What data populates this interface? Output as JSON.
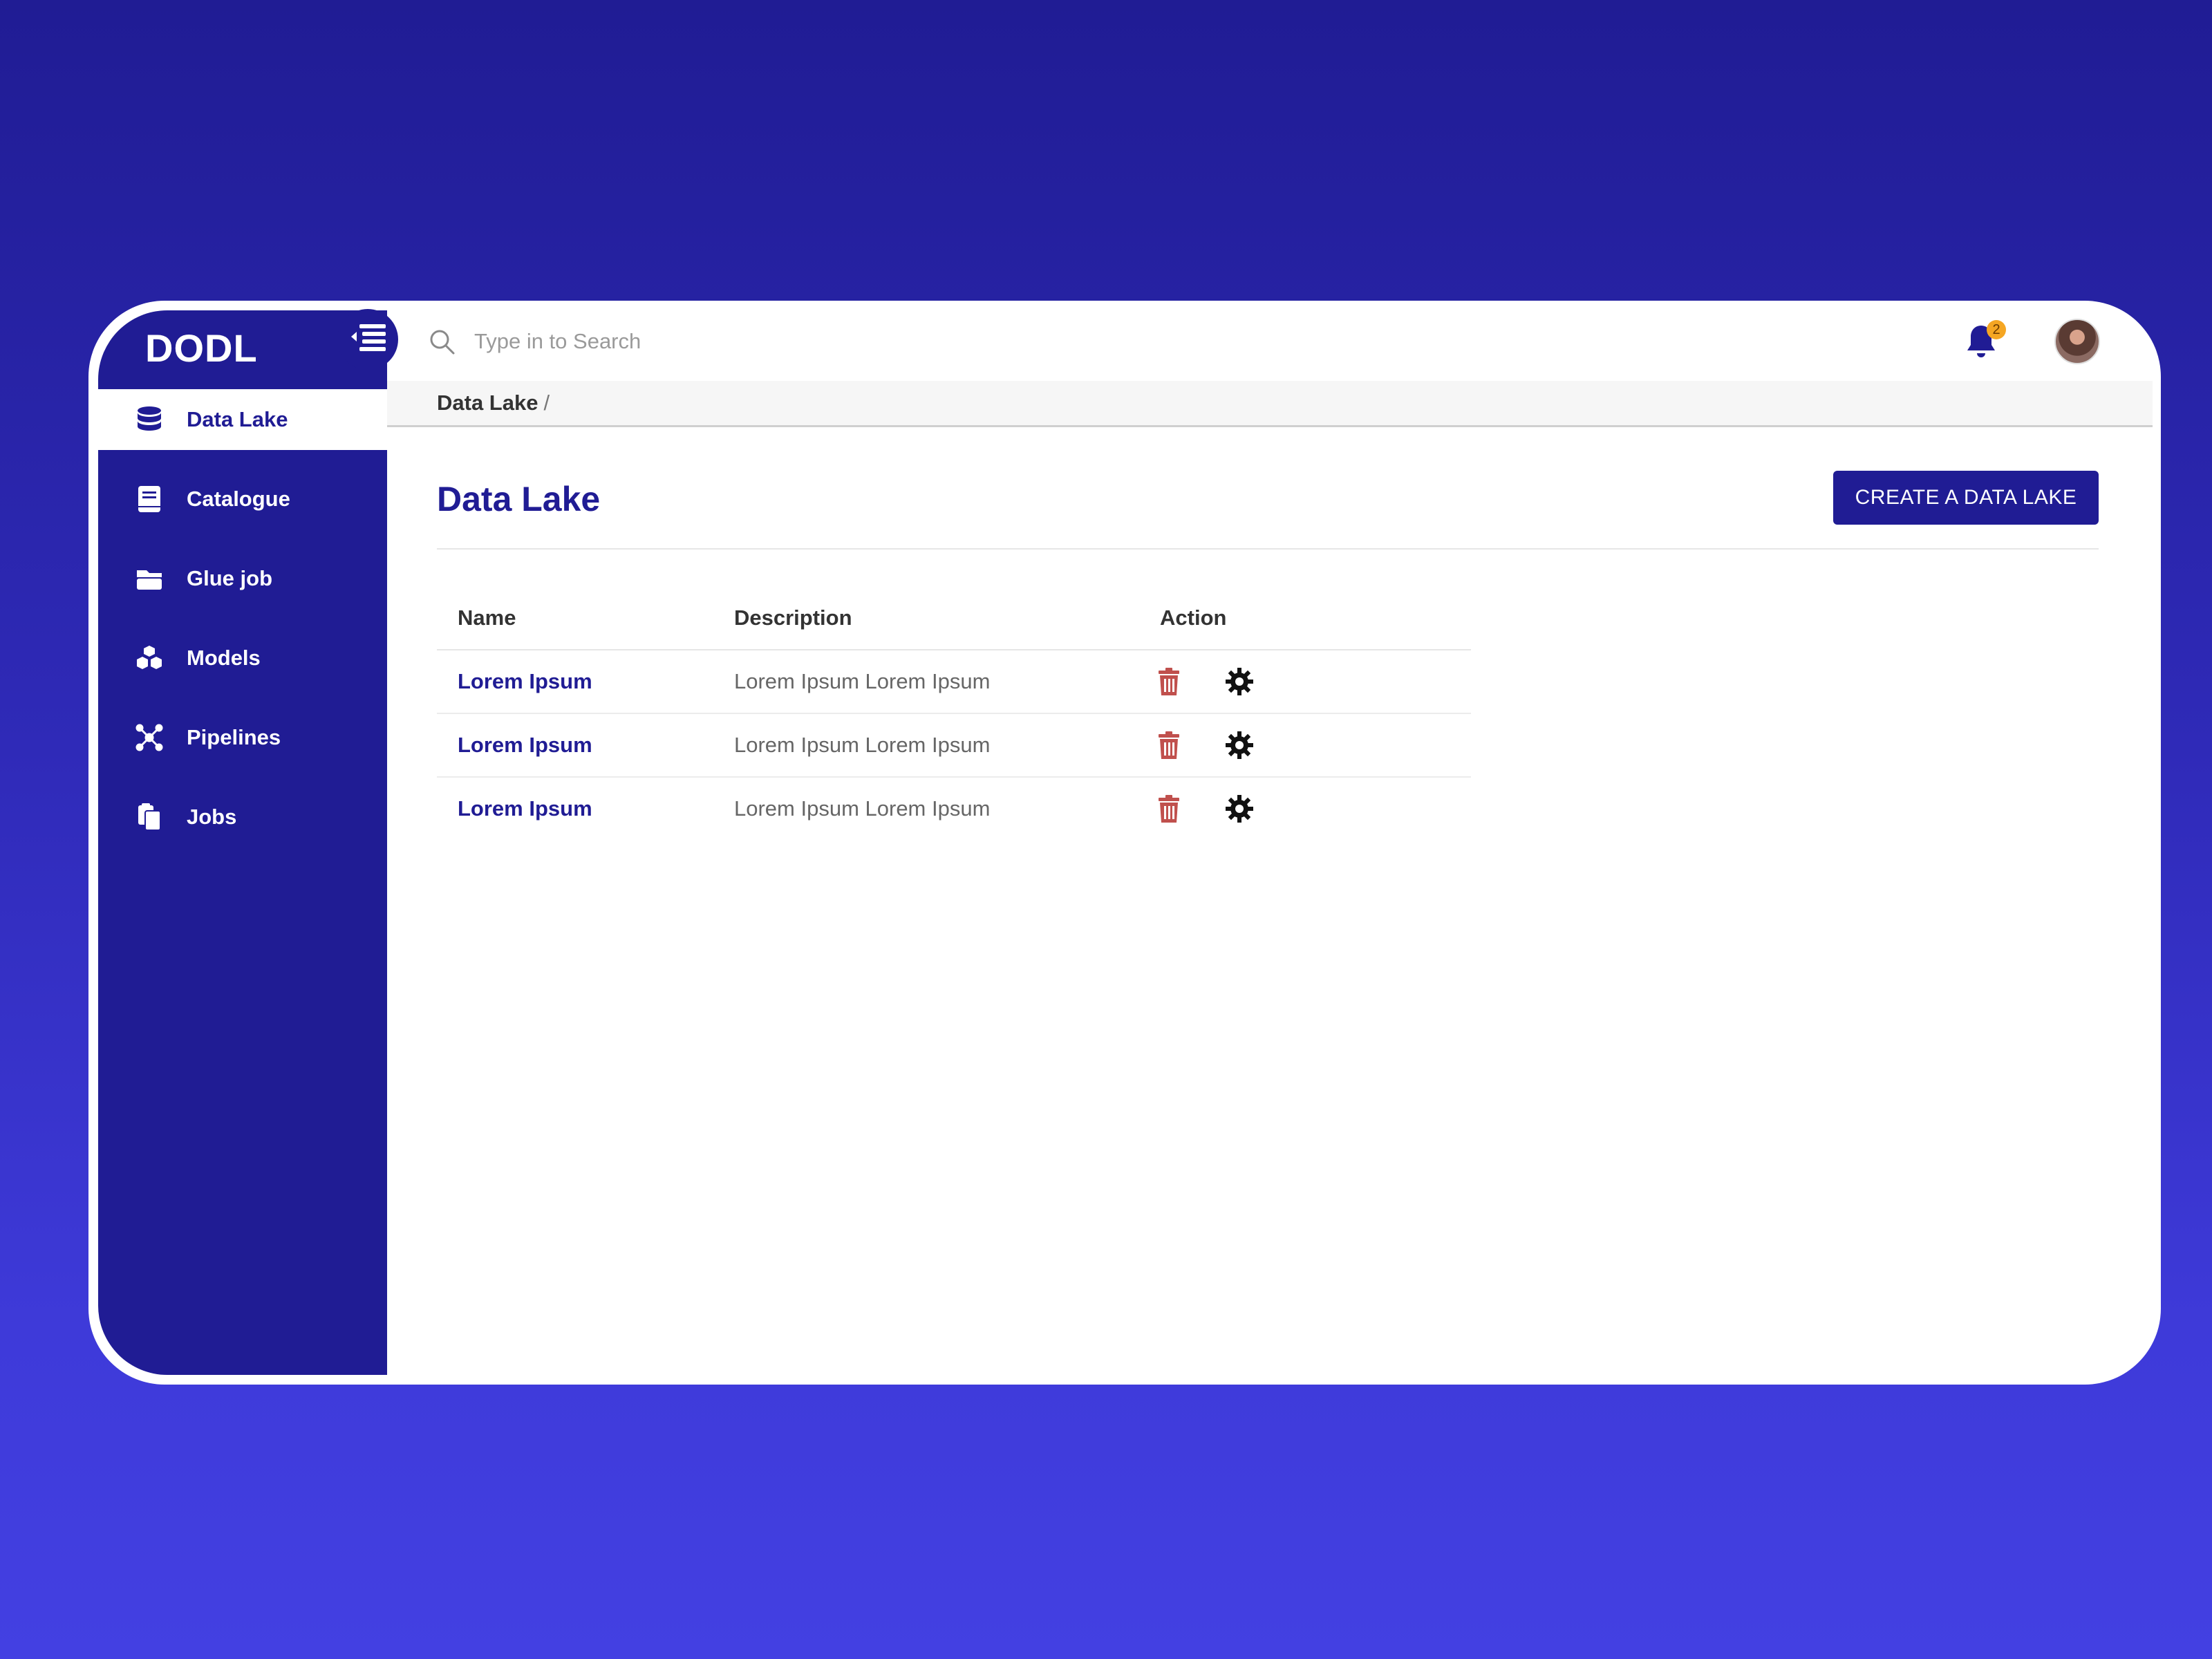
{
  "app": {
    "brand": "DODL"
  },
  "colors": {
    "primary": "#201c94",
    "delete": "#c0504d",
    "badge": "#f5a623"
  },
  "sidebar": {
    "items": [
      {
        "label": "Data Lake",
        "icon": "database-icon",
        "active": true
      },
      {
        "label": "Catalogue",
        "icon": "book-icon",
        "active": false
      },
      {
        "label": "Glue job",
        "icon": "folder-icon",
        "active": false
      },
      {
        "label": "Models",
        "icon": "cubes-icon",
        "active": false
      },
      {
        "label": "Pipelines",
        "icon": "network-icon",
        "active": false
      },
      {
        "label": "Jobs",
        "icon": "clipboard-icon",
        "active": false
      }
    ]
  },
  "header": {
    "search_placeholder": "Type in to Search",
    "notification_count": "2"
  },
  "breadcrumb": {
    "current": "Data Lake",
    "separator": "/"
  },
  "main": {
    "title": "Data Lake",
    "create_button": "CREATE A DATA LAKE",
    "table": {
      "columns": [
        "Name",
        "Description",
        "Action"
      ],
      "rows": [
        {
          "name": "Lorem Ipsum",
          "description": "Lorem Ipsum Lorem Ipsum"
        },
        {
          "name": "Lorem Ipsum",
          "description": "Lorem Ipsum Lorem Ipsum"
        },
        {
          "name": "Lorem Ipsum",
          "description": "Lorem Ipsum Lorem Ipsum"
        }
      ]
    }
  }
}
